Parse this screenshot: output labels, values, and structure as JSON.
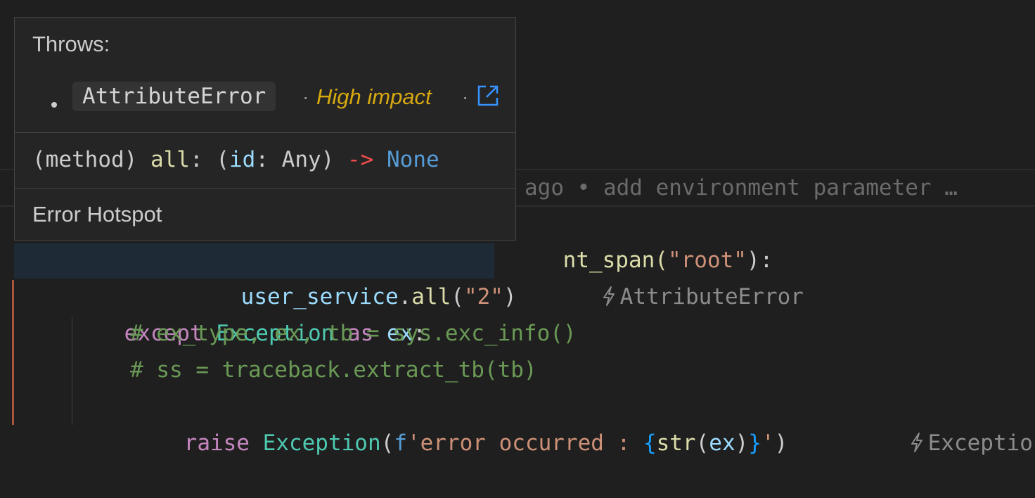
{
  "hover": {
    "throws_label": "Throws:",
    "exception_name": "AttributeError",
    "separator": "·",
    "impact": "High impact",
    "signature": {
      "kind": "(method)",
      "name": "all",
      "colon": ":",
      "params_open": "(",
      "param": "id",
      "param_colon": ":",
      "param_type": "Any",
      "params_close": ")",
      "arrow": "->",
      "return_type": "None"
    },
    "footer_label": "Error Hotspot",
    "external_link_icon": "external-link-icon"
  },
  "editor": {
    "blame": "ago • add environment parameter …",
    "line_span": {
      "frag": "nt_span(",
      "arg": "\"root\"",
      "end": "):"
    },
    "line_call": {
      "obj": "user_service",
      "dot": ".",
      "fn": "all",
      "open": "(",
      "arg": "\"2\"",
      "close": ")",
      "annotation": "AttributeError"
    },
    "line_except": {
      "kw": "except",
      "cls": "Exception",
      "as": "as",
      "var": "ex",
      "colon": ":"
    },
    "comment1": "# ex_type, ex, tb = sys.exc_info()",
    "comment2": "# ss = traceback.extract_tb(tb)",
    "line_raise": {
      "kw": "raise",
      "cls": "Exception",
      "open": "(",
      "fprefix": "f",
      "str_a": "'error occurred : ",
      "brace_open": "{",
      "fn": "str",
      "p_open": "(",
      "var": "ex",
      "p_close": ")",
      "brace_close": "}",
      "str_b": "'",
      "close": ")",
      "annotation": "Exception"
    },
    "annotation_icon": "lightning-bolt-icon"
  },
  "colors": {
    "background": "#1f1f1f",
    "hover_bg": "#252526",
    "impact": "#d7a90f",
    "link": "#3794ff",
    "arrow": "#f14c4c",
    "return_type": "#569cd6"
  }
}
